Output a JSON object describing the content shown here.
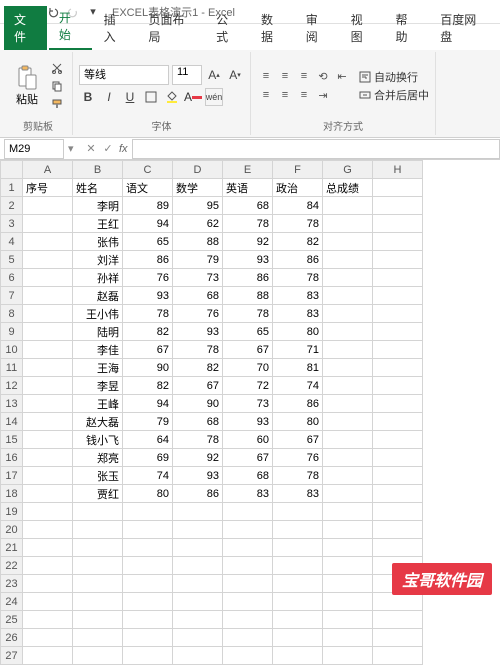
{
  "titlebar": {
    "doc_name": "EXCEL表格演示1",
    "app_name": "Excel"
  },
  "tabs": {
    "file": "文件",
    "home": "开始",
    "insert": "插入",
    "layout": "页面布局",
    "formulas": "公式",
    "data": "数据",
    "review": "审阅",
    "view": "视图",
    "help": "帮助",
    "baidu": "百度网盘"
  },
  "ribbon": {
    "clipboard": {
      "paste": "粘贴",
      "label": "剪贴板"
    },
    "font": {
      "name": "等线",
      "size": "11",
      "label": "字体"
    },
    "align": {
      "wrap": "自动换行",
      "merge": "合并后居中",
      "label": "对齐方式"
    }
  },
  "namebox": {
    "cell": "M29",
    "formula": ""
  },
  "grid": {
    "cols": [
      "A",
      "B",
      "C",
      "D",
      "E",
      "F",
      "G",
      "H"
    ],
    "headers": [
      "序号",
      "姓名",
      "语文",
      "数学",
      "英语",
      "政治",
      "总成绩"
    ],
    "rows": [
      {
        "name": "李明",
        "c": 89,
        "d": 95,
        "e": 68,
        "f": 84
      },
      {
        "name": "王红",
        "c": 94,
        "d": 62,
        "e": 78,
        "f": 78
      },
      {
        "name": "张伟",
        "c": 65,
        "d": 88,
        "e": 92,
        "f": 82
      },
      {
        "name": "刘洋",
        "c": 86,
        "d": 79,
        "e": 93,
        "f": 86
      },
      {
        "name": "孙祥",
        "c": 76,
        "d": 73,
        "e": 86,
        "f": 78
      },
      {
        "name": "赵磊",
        "c": 93,
        "d": 68,
        "e": 88,
        "f": 83
      },
      {
        "name": "王小伟",
        "c": 78,
        "d": 76,
        "e": 78,
        "f": 83
      },
      {
        "name": "陆明",
        "c": 82,
        "d": 93,
        "e": 65,
        "f": 80
      },
      {
        "name": "李佳",
        "c": 67,
        "d": 78,
        "e": 67,
        "f": 71
      },
      {
        "name": "王海",
        "c": 90,
        "d": 82,
        "e": 70,
        "f": 81
      },
      {
        "name": "李昱",
        "c": 82,
        "d": 67,
        "e": 72,
        "f": 74
      },
      {
        "name": "王峰",
        "c": 94,
        "d": 90,
        "e": 73,
        "f": 86
      },
      {
        "name": "赵大磊",
        "c": 79,
        "d": 68,
        "e": 93,
        "f": 80
      },
      {
        "name": "钱小飞",
        "c": 64,
        "d": 78,
        "e": 60,
        "f": 67
      },
      {
        "name": "郑亮",
        "c": 69,
        "d": 92,
        "e": 67,
        "f": 76
      },
      {
        "name": "张玉",
        "c": 74,
        "d": 93,
        "e": 68,
        "f": 78
      },
      {
        "name": "贾红",
        "c": 80,
        "d": 86,
        "e": 83,
        "f": 83
      }
    ],
    "blank_rows": 9
  },
  "watermark": "宝哥软件园",
  "chart_data": {
    "type": "table",
    "title": "",
    "columns": [
      "姓名",
      "语文",
      "数学",
      "英语",
      "政治"
    ],
    "series": [
      {
        "name": "语文",
        "values": [
          89,
          94,
          65,
          86,
          76,
          93,
          78,
          82,
          67,
          90,
          82,
          94,
          79,
          64,
          69,
          74,
          80
        ]
      },
      {
        "name": "数学",
        "values": [
          95,
          62,
          88,
          79,
          73,
          68,
          76,
          93,
          78,
          82,
          67,
          90,
          68,
          78,
          92,
          93,
          86
        ]
      },
      {
        "name": "英语",
        "values": [
          68,
          78,
          92,
          93,
          86,
          88,
          78,
          65,
          67,
          70,
          72,
          73,
          93,
          60,
          67,
          68,
          83
        ]
      },
      {
        "name": "政治",
        "values": [
          84,
          78,
          82,
          86,
          78,
          83,
          83,
          80,
          71,
          81,
          74,
          86,
          80,
          67,
          76,
          78,
          83
        ]
      }
    ],
    "categories": [
      "李明",
      "王红",
      "张伟",
      "刘洋",
      "孙祥",
      "赵磊",
      "王小伟",
      "陆明",
      "李佳",
      "王海",
      "李昱",
      "王峰",
      "赵大磊",
      "钱小飞",
      "郑亮",
      "张玉",
      "贾红"
    ]
  }
}
